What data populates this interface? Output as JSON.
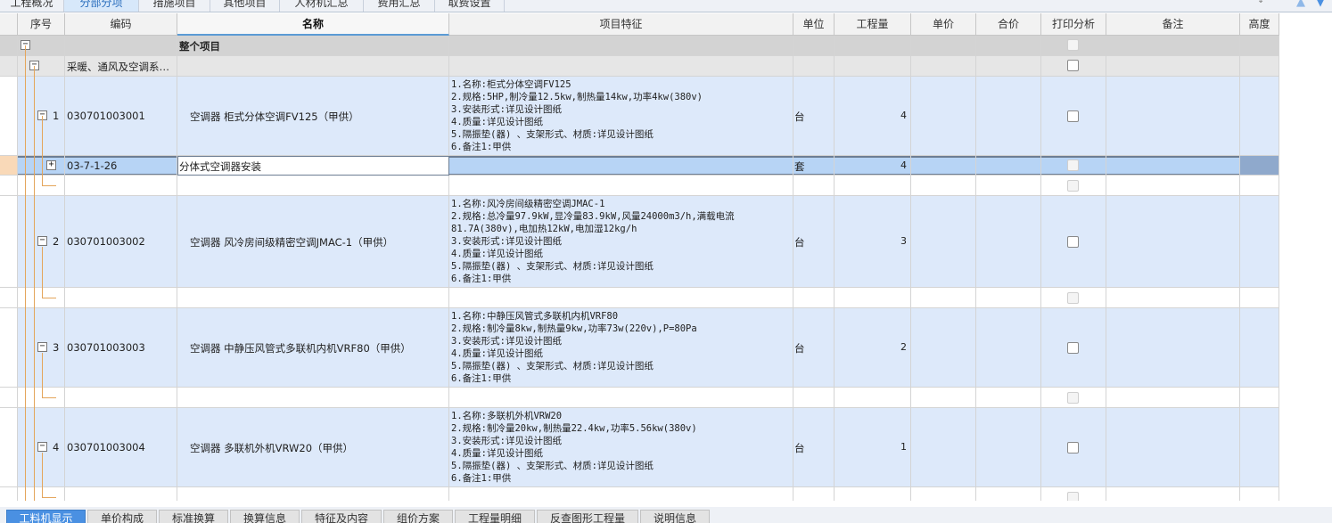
{
  "top_tabs": [
    "工程概况",
    "分部分项",
    "措施项目",
    "其他项目",
    "人材机汇总",
    "费用汇总",
    "取费设置"
  ],
  "columns": {
    "seq": "序号",
    "code": "编码",
    "name": "名称",
    "feature": "项目特征",
    "unit": "单位",
    "qty": "工程量",
    "price": "单价",
    "total": "合价",
    "print": "打印分析",
    "remark": "备注",
    "height": "高度"
  },
  "rows": {
    "whole": {
      "name": "整个项目"
    },
    "section": {
      "code": "采暖、通风及空调系…"
    },
    "item1": {
      "seq": "1",
      "code": "030701003001",
      "name": "空调器 柜式分体空调FV125（甲供）",
      "feature": "1.名称:柜式分体空调FV125\n2.规格:5HP,制冷量12.5kw,制热量14kw,功率4kw(380v)\n3.安装形式:详见设计图纸\n4.质量:详见设计图纸\n5.隔振垫(器) 、支架形式、材质:详见设计图纸\n6.备注1:甲供",
      "unit": "台",
      "qty": "4"
    },
    "sub1": {
      "code": "03-7-1-26",
      "name": "分体式空调器安装",
      "unit": "套",
      "qty": "4"
    },
    "item2": {
      "seq": "2",
      "code": "030701003002",
      "name": "空调器 风冷房间级精密空调JMAC-1（甲供）",
      "feature": "1.名称:风冷房间级精密空调JMAC-1\n2.规格:总冷量97.9kW,显冷量83.9kW,风量24000m3/h,满载电流\n81.7A(380v),电加热12kW,电加湿12kg/h\n3.安装形式:详见设计图纸\n4.质量:详见设计图纸\n5.隔振垫(器) 、支架形式、材质:详见设计图纸\n6.备注1:甲供",
      "unit": "台",
      "qty": "3"
    },
    "item3": {
      "seq": "3",
      "code": "030701003003",
      "name": "空调器 中静压风管式多联机内机VRF80（甲供）",
      "feature": "1.名称:中静压风管式多联机内机VRF80\n2.规格:制冷量8kw,制热量9kw,功率73w(220v),P=80Pa\n3.安装形式:详见设计图纸\n4.质量:详见设计图纸\n5.隔振垫(器) 、支架形式、材质:详见设计图纸\n6.备注1:甲供",
      "unit": "台",
      "qty": "2"
    },
    "item4": {
      "seq": "4",
      "code": "030701003004",
      "name": "空调器 多联机外机VRW20（甲供）",
      "feature": "1.名称:多联机外机VRW20\n2.规格:制冷量20kw,制热量22.4kw,功率5.56kw(380v)\n3.安装形式:详见设计图纸\n4.质量:详见设计图纸\n5.隔振垫(器) 、支架形式、材质:详见设计图纸\n6.备注1:甲供",
      "unit": "台",
      "qty": "1"
    }
  },
  "bottom_tabs": [
    "工料机显示",
    "单价构成",
    "标准换算",
    "换算信息",
    "特征及内容",
    "组价方案",
    "工程量明细",
    "反查图形工程量",
    "说明信息"
  ],
  "colors": {
    "accent": "#4a90e2",
    "item_row": "#dde9fa",
    "tree_line": "#e4a55b"
  }
}
